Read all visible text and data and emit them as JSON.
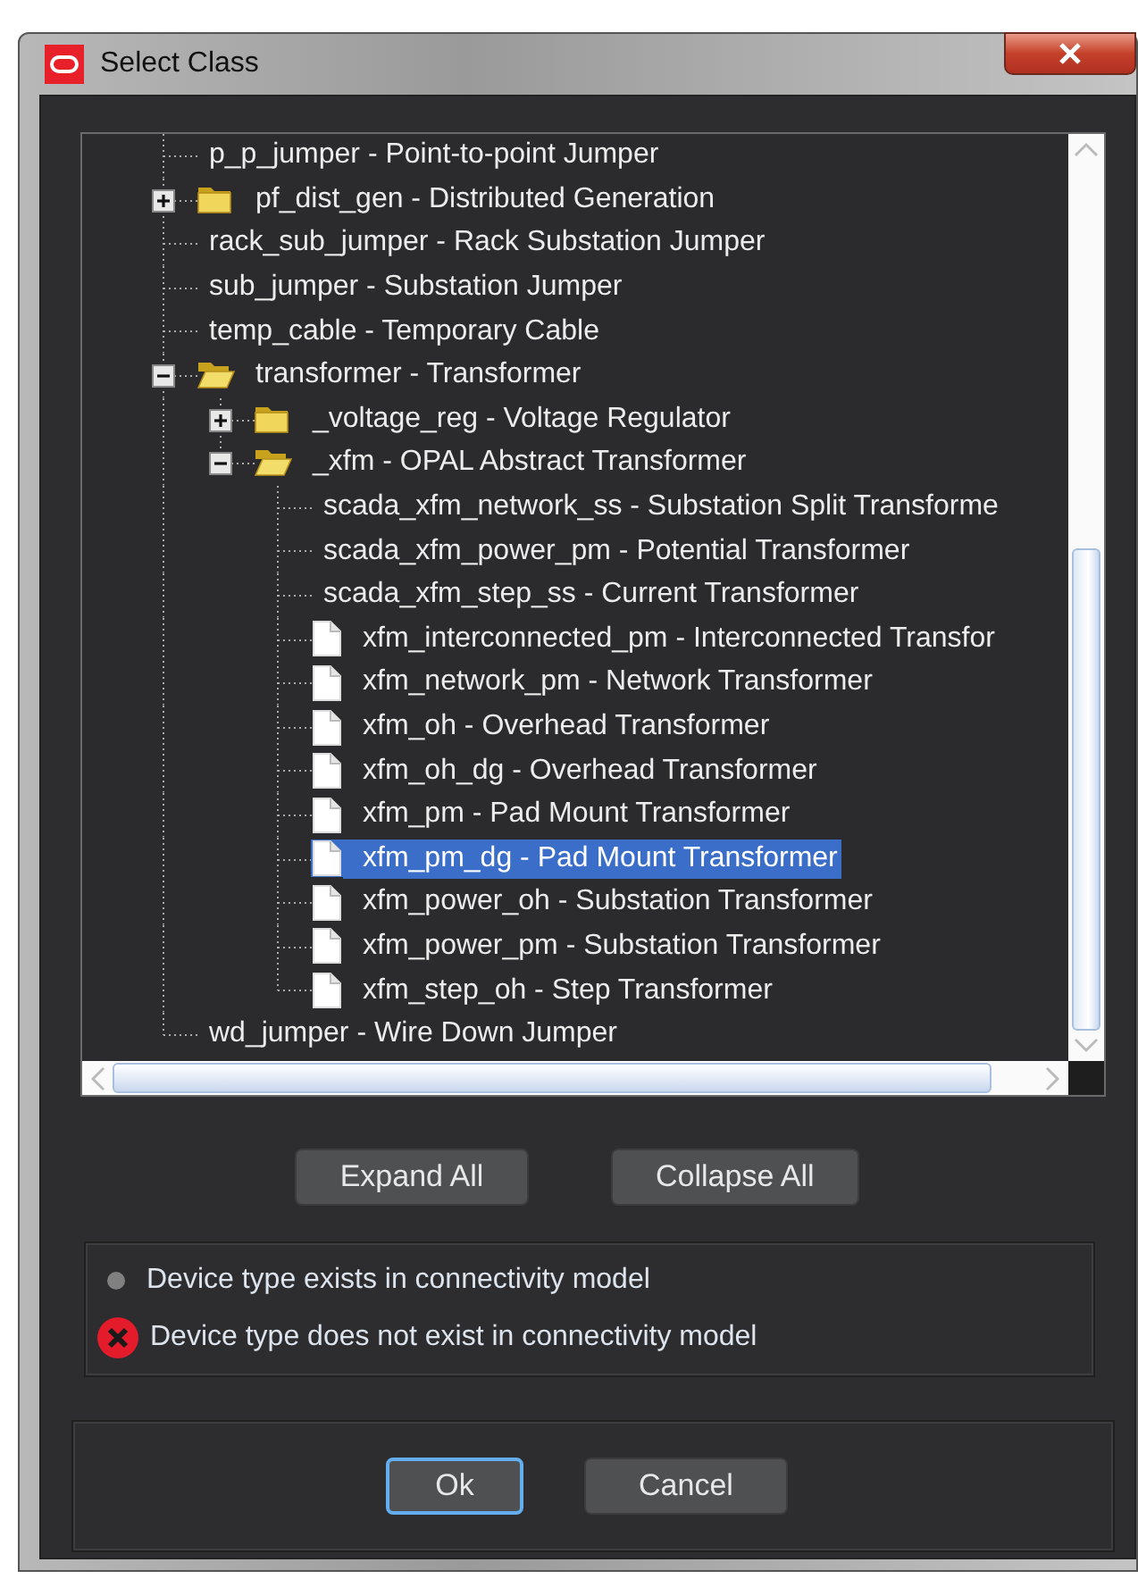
{
  "window": {
    "title": "Select Class"
  },
  "tree": {
    "items": [
      {
        "label": "p_p_jumper - Point-to-point Jumper",
        "kind": "leaf",
        "selected": false
      },
      {
        "label": "pf_dist_gen - Distributed Generation",
        "kind": "folder",
        "expanded": false,
        "selected": false
      },
      {
        "label": "rack_sub_jumper - Rack Substation Jumper",
        "kind": "leaf",
        "selected": false
      },
      {
        "label": "sub_jumper - Substation Jumper",
        "kind": "leaf",
        "selected": false
      },
      {
        "label": "temp_cable - Temporary Cable",
        "kind": "leaf",
        "selected": false
      },
      {
        "label": "transformer - Transformer",
        "kind": "folder",
        "expanded": true,
        "selected": false,
        "children": [
          {
            "label": "_voltage_reg - Voltage Regulator",
            "kind": "folder",
            "expanded": false,
            "selected": false
          },
          {
            "label": "_xfm - OPAL Abstract Transformer",
            "kind": "folder",
            "expanded": true,
            "selected": false,
            "children": [
              {
                "label": "scada_xfm_network_ss - Substation Split Transforme",
                "kind": "leaf",
                "selected": false
              },
              {
                "label": "scada_xfm_power_pm - Potential Transformer",
                "kind": "leaf",
                "selected": false
              },
              {
                "label": "scada_xfm_step_ss - Current Transformer",
                "kind": "leaf",
                "selected": false
              },
              {
                "label": "xfm_interconnected_pm - Interconnected Transfor",
                "kind": "file",
                "selected": false
              },
              {
                "label": "xfm_network_pm - Network Transformer",
                "kind": "file",
                "selected": false
              },
              {
                "label": "xfm_oh - Overhead Transformer",
                "kind": "file",
                "selected": false
              },
              {
                "label": "xfm_oh_dg - Overhead Transformer",
                "kind": "file",
                "selected": false
              },
              {
                "label": "xfm_pm - Pad Mount Transformer",
                "kind": "file",
                "selected": false
              },
              {
                "label": "xfm_pm_dg - Pad Mount Transformer",
                "kind": "file",
                "selected": true
              },
              {
                "label": "xfm_power_oh - Substation Transformer",
                "kind": "file",
                "selected": false
              },
              {
                "label": "xfm_power_pm - Substation Transformer",
                "kind": "file",
                "selected": false
              },
              {
                "label": "xfm_step_oh - Step Transformer",
                "kind": "file",
                "selected": false
              }
            ]
          }
        ]
      },
      {
        "label": "wd_jumper - Wire Down Jumper",
        "kind": "leaf",
        "selected": false
      }
    ]
  },
  "tree_buttons": [
    {
      "label": "Expand All"
    },
    {
      "label": "Collapse All"
    }
  ],
  "legend": [
    {
      "kind": "exists",
      "label": "Device type exists in connectivity model"
    },
    {
      "kind": "missing",
      "label": "Device type does not exist in connectivity model"
    }
  ],
  "dialog_buttons": [
    {
      "label": "Ok",
      "focused": true
    },
    {
      "label": "Cancel",
      "focused": false
    }
  ]
}
